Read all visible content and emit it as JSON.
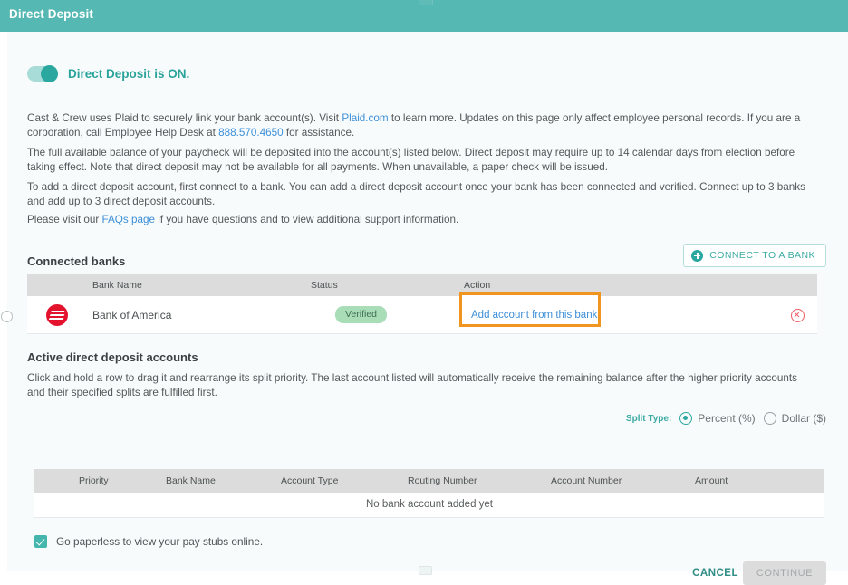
{
  "header": {
    "title": "Direct Deposit"
  },
  "toggle": {
    "label": "Direct Deposit is  ON.",
    "state": "on"
  },
  "intro": {
    "p1_a": "Cast & Crew uses Plaid to securely link your bank account(s). Visit ",
    "p1_link1": "Plaid.com",
    "p1_b": " to learn more. Updates on this page only affect employee personal records. If you are a corporation, call Employee Help Desk at ",
    "p1_link2": "888.570.4650",
    "p1_c": " for assistance.",
    "p2": "The full available balance of your paycheck will be deposited into the account(s) listed below. Direct deposit may require up to 14 calendar days from election before taking effect. Note that direct deposit may not be available for all payments. When unavailable, a paper check will be issued.",
    "p3": "To add a direct deposit account, first connect to a bank. You can add a direct deposit account once your bank has been connected and verified. Connect up to 3 banks and add up to 3 direct deposit accounts.",
    "p4_a": "Please visit our ",
    "p4_link": "FAQs page",
    "p4_b": " if you have questions and to view additional support information."
  },
  "connected_banks": {
    "heading": "Connected banks",
    "connect_button": "CONNECT TO A BANK",
    "columns": {
      "bank_name": "Bank Name",
      "status": "Status",
      "action": "Action"
    },
    "rows": [
      {
        "logo": "bank-of-america-logo",
        "bank_name": "Bank of America",
        "status": "Verified",
        "action": "Add account from this bank",
        "highlighted": true
      }
    ]
  },
  "active_accounts": {
    "heading": "Active direct deposit accounts",
    "description": "Click and hold a row to drag it and rearrange its split priority. The last account listed will automatically receive the remaining balance after the higher priority accounts and their specified splits are fulfilled first.",
    "split_type_label": "Split Type:",
    "split_options": [
      {
        "label": "Percent (%)",
        "selected": true
      },
      {
        "label": "Dollar ($)",
        "selected": false
      }
    ],
    "columns": [
      "Priority",
      "Bank Name",
      "Account Type",
      "Routing Number",
      "Account Number",
      "Amount"
    ],
    "empty_message": "No bank account added yet"
  },
  "footer": {
    "paperless_label": "Go paperless to view your pay stubs online.",
    "paperless_checked": true,
    "cancel": "CANCEL",
    "continue": "CONTINUE"
  },
  "colors": {
    "brand_teal": "#55b8b2",
    "accent_teal": "#2aa8a0",
    "link_blue": "#3d8fd8",
    "highlight_orange": "#f0951f",
    "badge_green": "#a9ddb8",
    "danger_red": "#ef5c62",
    "bank_red": "#e3122d"
  }
}
